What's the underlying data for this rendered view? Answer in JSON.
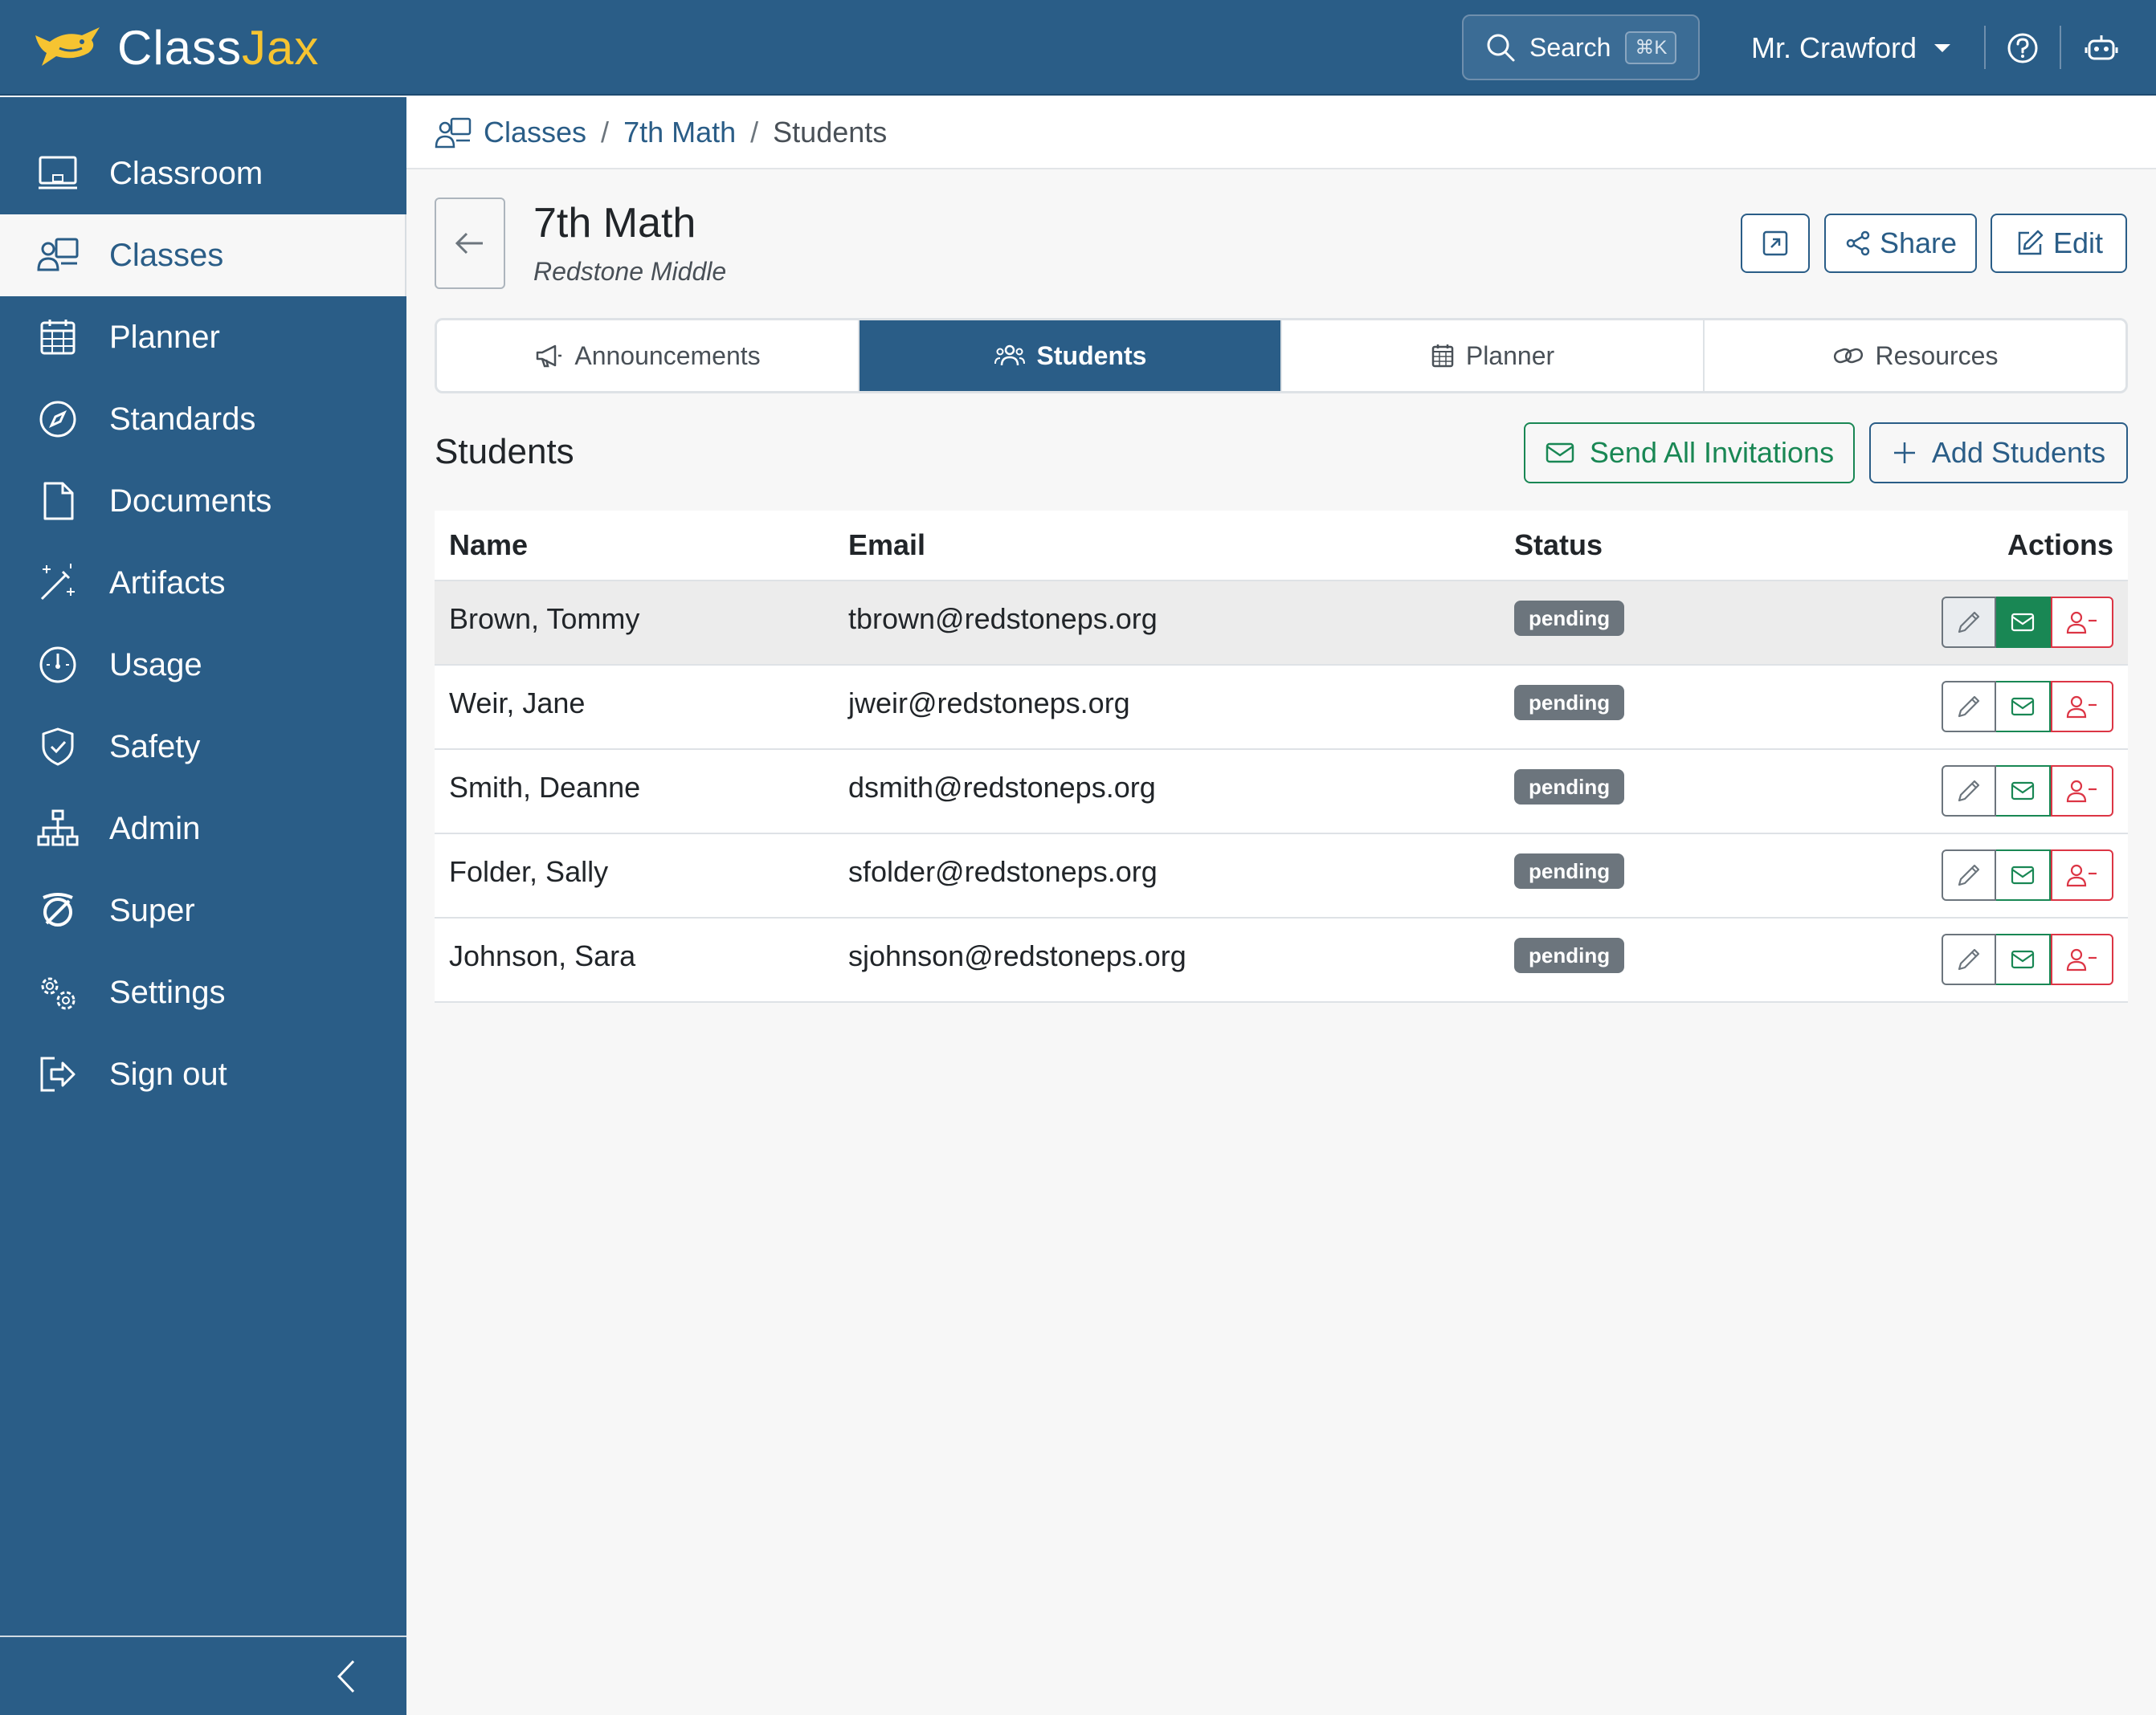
{
  "brand": {
    "name_part1": "Class",
    "name_part2": "Jax"
  },
  "topbar": {
    "search_label": "Search",
    "search_shortcut": "⌘K",
    "user_name": "Mr. Crawford"
  },
  "sidebar": {
    "items": [
      {
        "label": "Classroom",
        "icon": "monitor-icon"
      },
      {
        "label": "Classes",
        "icon": "class-people-icon",
        "active": true
      },
      {
        "label": "Planner",
        "icon": "calendar-icon"
      },
      {
        "label": "Standards",
        "icon": "compass-icon"
      },
      {
        "label": "Documents",
        "icon": "document-icon"
      },
      {
        "label": "Artifacts",
        "icon": "magic-wand-icon"
      },
      {
        "label": "Usage",
        "icon": "speedometer-icon"
      },
      {
        "label": "Safety",
        "icon": "shield-check-icon"
      },
      {
        "label": "Admin",
        "icon": "org-chart-icon"
      },
      {
        "label": "Super",
        "icon": "super-icon"
      },
      {
        "label": "Settings",
        "icon": "gears-icon"
      },
      {
        "label": "Sign out",
        "icon": "sign-out-icon"
      }
    ]
  },
  "breadcrumb": {
    "items": [
      "Classes",
      "7th Math"
    ],
    "current": "Students",
    "separator": "/"
  },
  "class_header": {
    "title": "7th Math",
    "school": "Redstone Middle",
    "share_label": "Share",
    "edit_label": "Edit"
  },
  "tabs": [
    {
      "label": "Announcements",
      "icon": "megaphone-icon"
    },
    {
      "label": "Students",
      "icon": "people-icon",
      "active": true
    },
    {
      "label": "Planner",
      "icon": "calendar-icon"
    },
    {
      "label": "Resources",
      "icon": "link-icon"
    }
  ],
  "students_section": {
    "title": "Students",
    "send_all_label": "Send All Invitations",
    "add_students_label": "Add Students"
  },
  "table": {
    "columns": [
      "Name",
      "Email",
      "Status",
      "Actions"
    ],
    "rows": [
      {
        "name": "Brown, Tommy",
        "email": "tbrown@redstoneps.org",
        "status": "pending"
      },
      {
        "name": "Weir, Jane",
        "email": "jweir@redstoneps.org",
        "status": "pending"
      },
      {
        "name": "Smith, Deanne",
        "email": "dsmith@redstoneps.org",
        "status": "pending"
      },
      {
        "name": "Folder, Sally",
        "email": "sfolder@redstoneps.org",
        "status": "pending"
      },
      {
        "name": "Johnson, Sara",
        "email": "sjohnson@redstoneps.org",
        "status": "pending"
      }
    ]
  },
  "colors": {
    "primary": "#2a5d87",
    "brand_accent": "#f6c431",
    "success": "#198754",
    "danger": "#dc3545",
    "badge": "#6c757d"
  }
}
